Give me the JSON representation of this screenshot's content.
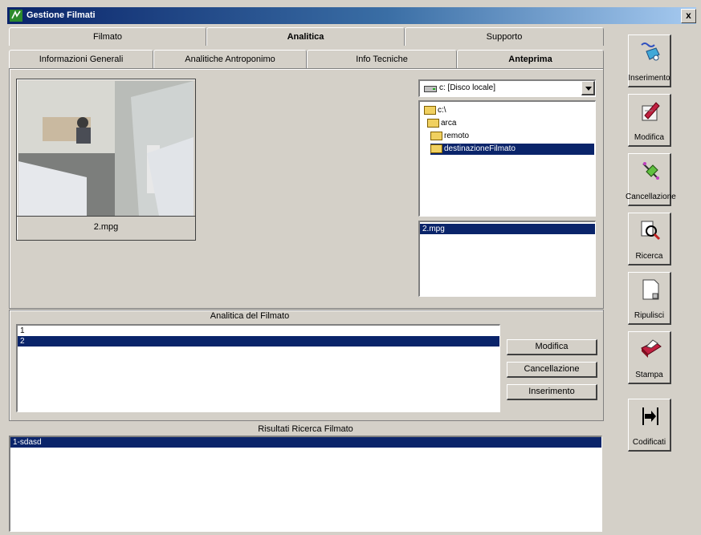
{
  "window": {
    "title": "Gestione Filmati",
    "close_label": "x"
  },
  "main_tabs": [
    {
      "label": "Filmato"
    },
    {
      "label": "Analitica"
    },
    {
      "label": "Supporto"
    }
  ],
  "sub_tabs": [
    {
      "label": "Informazioni Generali"
    },
    {
      "label": "Analitiche Antroponimo"
    },
    {
      "label": "Info Tecniche"
    },
    {
      "label": "Anteprima"
    }
  ],
  "preview": {
    "file_label": "2.mpg"
  },
  "drive": {
    "selected": "c: [Disco locale]"
  },
  "folders": [
    {
      "label": "c:\\"
    },
    {
      "label": "arca"
    },
    {
      "label": "remoto"
    },
    {
      "label": "destinazioneFilmato"
    }
  ],
  "files": [
    {
      "label": "2.mpg"
    }
  ],
  "analitica": {
    "title": "Analitica del Filmato",
    "rows": [
      "1",
      "2"
    ],
    "buttons": {
      "modifica": "Modifica",
      "cancellazione": "Cancellazione",
      "inserimento": "Inserimento"
    }
  },
  "risultati": {
    "title": "Risultati Ricerca Filmato",
    "rows": [
      "1-sdasd"
    ]
  },
  "sidebar": {
    "buttons": [
      {
        "label": "Inserimento",
        "icon": "insert-icon"
      },
      {
        "label": "Modifica",
        "icon": "edit-icon"
      },
      {
        "label": "Cancellazione",
        "icon": "delete-icon"
      },
      {
        "label": "Ricerca",
        "icon": "search-icon"
      },
      {
        "label": "Ripulisci",
        "icon": "clear-icon"
      },
      {
        "label": "Stampa",
        "icon": "printer-icon"
      },
      {
        "label": "Codificati",
        "icon": "codify-icon"
      }
    ]
  },
  "colors": {
    "selection": "#0a246a",
    "face": "#d4d0c8",
    "title_start": "#0a246a",
    "title_end": "#a6caf0"
  }
}
